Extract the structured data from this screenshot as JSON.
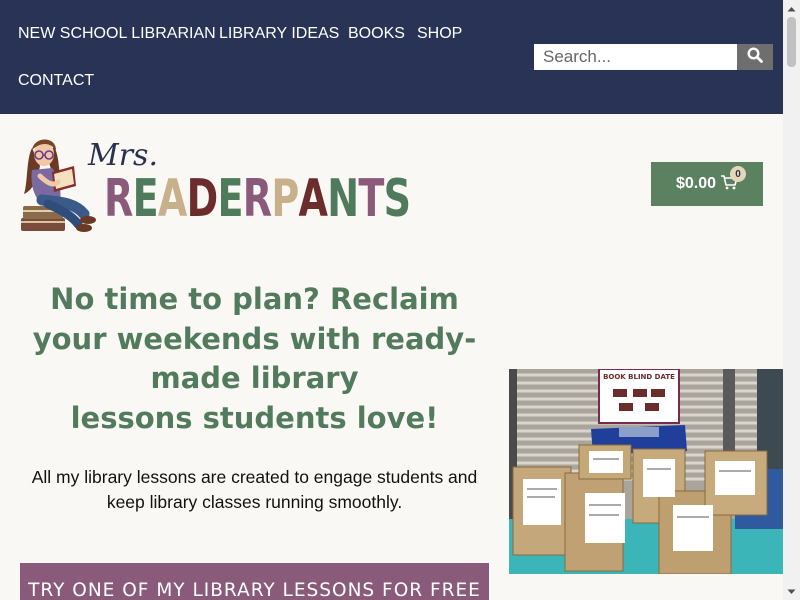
{
  "nav": {
    "links": [
      "NEW SCHOOL LIBRARIAN",
      "LIBRARY IDEAS",
      "BOOKS",
      "SHOP",
      "CONTACT"
    ],
    "search_placeholder": "Search...",
    "search_icon": "magnifier-icon"
  },
  "logo": {
    "prefix": "Mrs.",
    "name": "READERPANTS",
    "letter_colors": [
      "#8a5a7a",
      "#4f7a5b",
      "#c8b08a",
      "#6b2c2c",
      "#4f7a5b",
      "#8a5a7a",
      "#c8b08a",
      "#6b2c2c",
      "#4f7a5b",
      "#8a5a7a",
      "#4f7a5b"
    ]
  },
  "cart": {
    "amount": "$0.00",
    "count": "0",
    "icon": "cart-icon"
  },
  "hero": {
    "title_lines": [
      "No time to plan? Reclaim",
      "your weekends with ready-",
      "made library",
      "lessons students love!"
    ],
    "description": "All my library lessons are created to engage students and keep library classes running smoothly.",
    "cta_label": "TRY ONE OF MY LIBRARY LESSONS FOR FREE"
  },
  "photo": {
    "sign_title": "BOOK BLIND DATE"
  },
  "colors": {
    "nav_bg": "#283355",
    "accent_green": "#527a5c",
    "cart_green": "#5c8161",
    "cta_purple": "#8a5a7a",
    "page_bg": "#faf8f5"
  }
}
